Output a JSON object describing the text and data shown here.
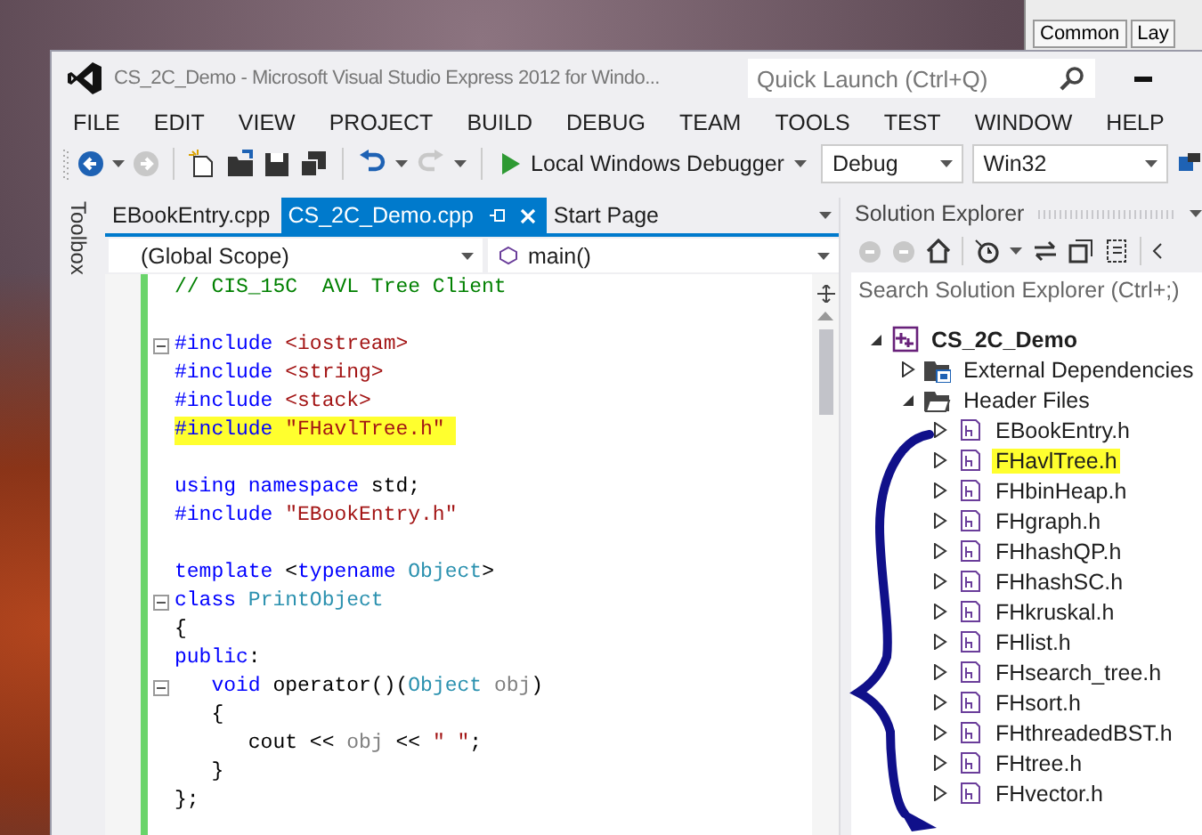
{
  "background_window": {
    "tabs": [
      "Common",
      "Lay"
    ]
  },
  "window": {
    "title": "CS_2C_Demo - Microsoft Visual Studio Express 2012 for Windo...",
    "quick_launch": {
      "placeholder": "Quick Launch (Ctrl+Q)"
    }
  },
  "menu": [
    "FILE",
    "EDIT",
    "VIEW",
    "PROJECT",
    "BUILD",
    "DEBUG",
    "TEAM",
    "TOOLS",
    "TEST",
    "WINDOW",
    "HELP"
  ],
  "toolbar": {
    "debugger": "Local Windows Debugger",
    "configuration": "Debug",
    "platform": "Win32"
  },
  "toolbox": {
    "label": "Toolbox"
  },
  "editor": {
    "tabs": [
      {
        "label": "EBookEntry.cpp",
        "selected": false
      },
      {
        "label": "CS_2C_Demo.cpp",
        "selected": true
      },
      {
        "label": "Start Page",
        "selected": false
      }
    ],
    "scope": "(Global Scope)",
    "member": "main()",
    "lines": [
      {
        "tokens": [
          {
            "kind": "comment",
            "text": "// CIS_15C  AVL Tree Client"
          }
        ],
        "fold": false,
        "highlighted": false
      },
      {
        "fold": false,
        "highlighted": false
      },
      {
        "tokens": [
          {
            "kind": "keyword",
            "text": "#include"
          },
          {
            "kind": "string",
            "text": " <iostream>"
          }
        ],
        "fold": true,
        "highlighted": false
      },
      {
        "tokens": [
          {
            "kind": "keyword",
            "text": "#include"
          },
          {
            "kind": "string",
            "text": " <string>"
          }
        ],
        "fold": false,
        "highlighted": false
      },
      {
        "tokens": [
          {
            "kind": "keyword",
            "text": "#include"
          },
          {
            "kind": "string",
            "text": " <stack>"
          }
        ],
        "fold": false,
        "highlighted": false
      },
      {
        "tokens": [
          {
            "kind": "keyword",
            "text": "#include"
          },
          {
            "kind": "string",
            "text": " \"FHavlTree.h\""
          }
        ],
        "fold": false,
        "highlighted": true
      },
      {
        "fold": false,
        "highlighted": false
      },
      {
        "tokens": [
          {
            "kind": "keyword",
            "text": "using namespace"
          },
          {
            "kind": "plain",
            "text": " std;"
          }
        ],
        "fold": false,
        "highlighted": false
      },
      {
        "tokens": [
          {
            "kind": "keyword",
            "text": "#include"
          },
          {
            "kind": "string",
            "text": " \"EBookEntry.h\""
          }
        ],
        "fold": false,
        "highlighted": false
      },
      {
        "fold": false,
        "highlighted": false
      },
      {
        "tokens": [
          {
            "kind": "keyword",
            "text": "template"
          },
          {
            "kind": "plain",
            "text": " <"
          },
          {
            "kind": "keyword",
            "text": "typename"
          },
          {
            "kind": "type",
            "text": " Object"
          },
          {
            "kind": "plain",
            "text": ">"
          }
        ],
        "fold": false,
        "highlighted": false
      },
      {
        "tokens": [
          {
            "kind": "keyword",
            "text": "class"
          },
          {
            "kind": "type",
            "text": " PrintObject"
          }
        ],
        "fold": true,
        "highlighted": false
      },
      {
        "tokens": [
          {
            "kind": "plain",
            "text": "{"
          }
        ],
        "fold": false,
        "highlighted": false
      },
      {
        "tokens": [
          {
            "kind": "keyword",
            "text": "public"
          },
          {
            "kind": "plain",
            "text": ":"
          }
        ],
        "fold": false,
        "highlighted": false
      },
      {
        "tokens": [
          {
            "kind": "keyword",
            "text": "   void"
          },
          {
            "kind": "plain",
            "text": " operator()("
          },
          {
            "kind": "type",
            "text": "Object"
          },
          {
            "kind": "param",
            "text": " obj"
          },
          {
            "kind": "plain",
            "text": ")"
          }
        ],
        "fold": true,
        "highlighted": false
      },
      {
        "tokens": [
          {
            "kind": "plain",
            "text": "   {"
          }
        ],
        "fold": false,
        "highlighted": false
      },
      {
        "tokens": [
          {
            "kind": "plain",
            "text": "      cout << "
          },
          {
            "kind": "param",
            "text": "obj"
          },
          {
            "kind": "plain",
            "text": " << "
          },
          {
            "kind": "string",
            "text": "\" \""
          },
          {
            "kind": "plain",
            "text": ";"
          }
        ],
        "fold": false,
        "highlighted": false
      },
      {
        "tokens": [
          {
            "kind": "plain",
            "text": "   }"
          }
        ],
        "fold": false,
        "highlighted": false
      },
      {
        "tokens": [
          {
            "kind": "plain",
            "text": "};"
          }
        ],
        "fold": false,
        "highlighted": false
      }
    ]
  },
  "solution_explorer": {
    "title": "Solution Explorer",
    "search": {
      "placeholder": "Search Solution Explorer (Ctrl+;)"
    },
    "tree": [
      {
        "label": "CS_2C_Demo",
        "kind": "project",
        "expanded": true,
        "highlighted": false,
        "children": [
          {
            "label": "External Dependencies",
            "kind": "references",
            "expanded": false,
            "highlighted": false
          },
          {
            "label": "Header Files",
            "kind": "folder",
            "expanded": true,
            "highlighted": false,
            "children": [
              {
                "label": "EBookEntry.h",
                "kind": "file",
                "expanded": false,
                "highlighted": false
              },
              {
                "label": "FHavlTree.h",
                "kind": "file",
                "expanded": false,
                "highlighted": true
              },
              {
                "label": "FHbinHeap.h",
                "kind": "file",
                "expanded": false,
                "highlighted": false
              },
              {
                "label": "FHgraph.h",
                "kind": "file",
                "expanded": false,
                "highlighted": false
              },
              {
                "label": "FHhashQP.h",
                "kind": "file",
                "expanded": false,
                "highlighted": false
              },
              {
                "label": "FHhashSC.h",
                "kind": "file",
                "expanded": false,
                "highlighted": false
              },
              {
                "label": "FHkruskal.h",
                "kind": "file",
                "expanded": false,
                "highlighted": false
              },
              {
                "label": "FHlist.h",
                "kind": "file",
                "expanded": false,
                "highlighted": false
              },
              {
                "label": "FHsearch_tree.h",
                "kind": "file",
                "expanded": false,
                "highlighted": false
              },
              {
                "label": "FHsort.h",
                "kind": "file",
                "expanded": false,
                "highlighted": false
              },
              {
                "label": "FHthreadedBST.h",
                "kind": "file",
                "expanded": false,
                "highlighted": false
              },
              {
                "label": "FHtree.h",
                "kind": "file",
                "expanded": false,
                "highlighted": false
              },
              {
                "label": "FHvector.h",
                "kind": "file",
                "expanded": false,
                "highlighted": false
              }
            ]
          }
        ]
      }
    ]
  }
}
